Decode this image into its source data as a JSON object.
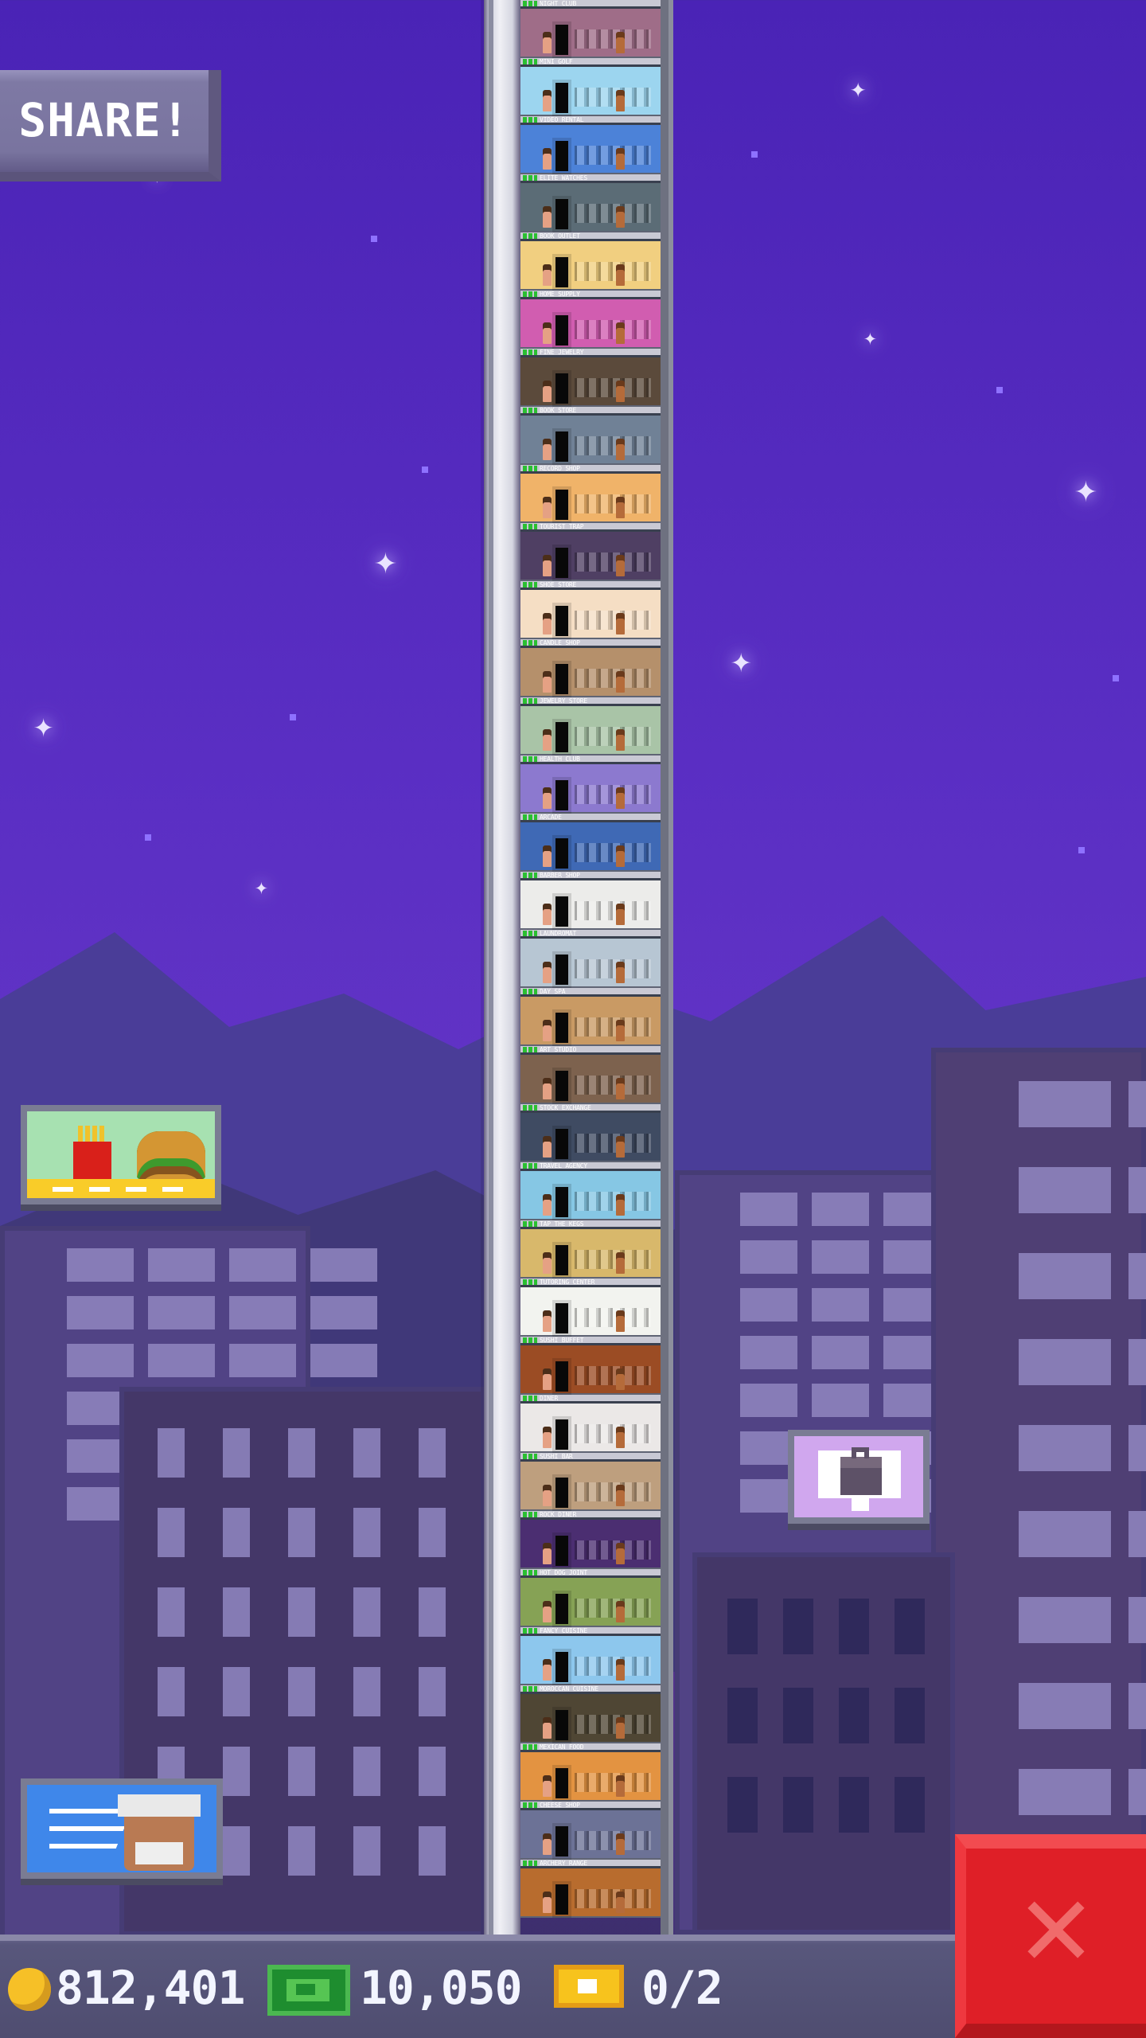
{
  "ui": {
    "share_label": "SHARE!",
    "close_label": "✕"
  },
  "status": {
    "coins": "812,401",
    "bux": "10,050",
    "tickets": "0/2"
  },
  "tower": {
    "floors": [
      {
        "label": "NIGHT CLUB",
        "color": "#9f6d88"
      },
      {
        "label": "MINI GOLF",
        "color": "#9cd5ef"
      },
      {
        "label": "VIDEO RENTAL",
        "color": "#4c82d8"
      },
      {
        "label": "ELITE WATCHES",
        "color": "#5b6c76"
      },
      {
        "label": "BOOK OUTLET",
        "color": "#f1cf80"
      },
      {
        "label": "HOME SUPPLY",
        "color": "#d15db0"
      },
      {
        "label": "FINE JEWELRY",
        "color": "#5b4a3b"
      },
      {
        "label": "BOOK STORE",
        "color": "#708196"
      },
      {
        "label": "RECORD SHOP",
        "color": "#f0b369"
      },
      {
        "label": "TOURIST TRAP",
        "color": "#4f3f63"
      },
      {
        "label": "SHOE STORE",
        "color": "#f5dec4"
      },
      {
        "label": "CANDLE SHOP",
        "color": "#b5906b"
      },
      {
        "label": "JEWELRY STORE",
        "color": "#a9c4a7"
      },
      {
        "label": "HEALTH CLUB",
        "color": "#8c79cf"
      },
      {
        "label": "ARCADE",
        "color": "#3f69b5"
      },
      {
        "label": "BARBER SHOP",
        "color": "#ececea"
      },
      {
        "label": "LAUNDROMAT",
        "color": "#b7c6d3"
      },
      {
        "label": "DAY SPA",
        "color": "#c99a64"
      },
      {
        "label": "ART STUDIO",
        "color": "#7d624e"
      },
      {
        "label": "STOCK EXCHANGE",
        "color": "#3f4b62"
      },
      {
        "label": "TRAVEL AGENCY",
        "color": "#86c7e4"
      },
      {
        "label": "TAP THE KEGS",
        "color": "#d8b86b"
      },
      {
        "label": "TUTORING CENTER",
        "color": "#f2f3ef"
      },
      {
        "label": "SUSHI BUFFET",
        "color": "#9b4c24"
      },
      {
        "label": "DINER",
        "color": "#ebe8e7"
      },
      {
        "label": "SUSHI BAR",
        "color": "#be9f7e"
      },
      {
        "label": "ROCK DINER",
        "color": "#4b2e71"
      },
      {
        "label": "HOT DOG JOINT",
        "color": "#86a255"
      },
      {
        "label": "FANCY CUISINE",
        "color": "#8dc7ed"
      },
      {
        "label": "MOROCCAN CUISINE",
        "color": "#4f4634"
      },
      {
        "label": "MEXICAN FOOD",
        "color": "#e39341"
      },
      {
        "label": "CHEESE SHOP",
        "color": "#6c7296"
      },
      {
        "label": "ARCHERY RANGE",
        "color": "#b86c2e"
      }
    ]
  },
  "colors": {
    "sky": "#5b2fc4",
    "accent_close": "#df1f27",
    "coin": "#f6c027",
    "bux": "#1e8d2f",
    "ticket": "#f7c31d"
  },
  "icons": {
    "coins": "coin-icon",
    "bux": "bux-icon",
    "tickets": "ticket-icon",
    "close": "close-icon"
  }
}
